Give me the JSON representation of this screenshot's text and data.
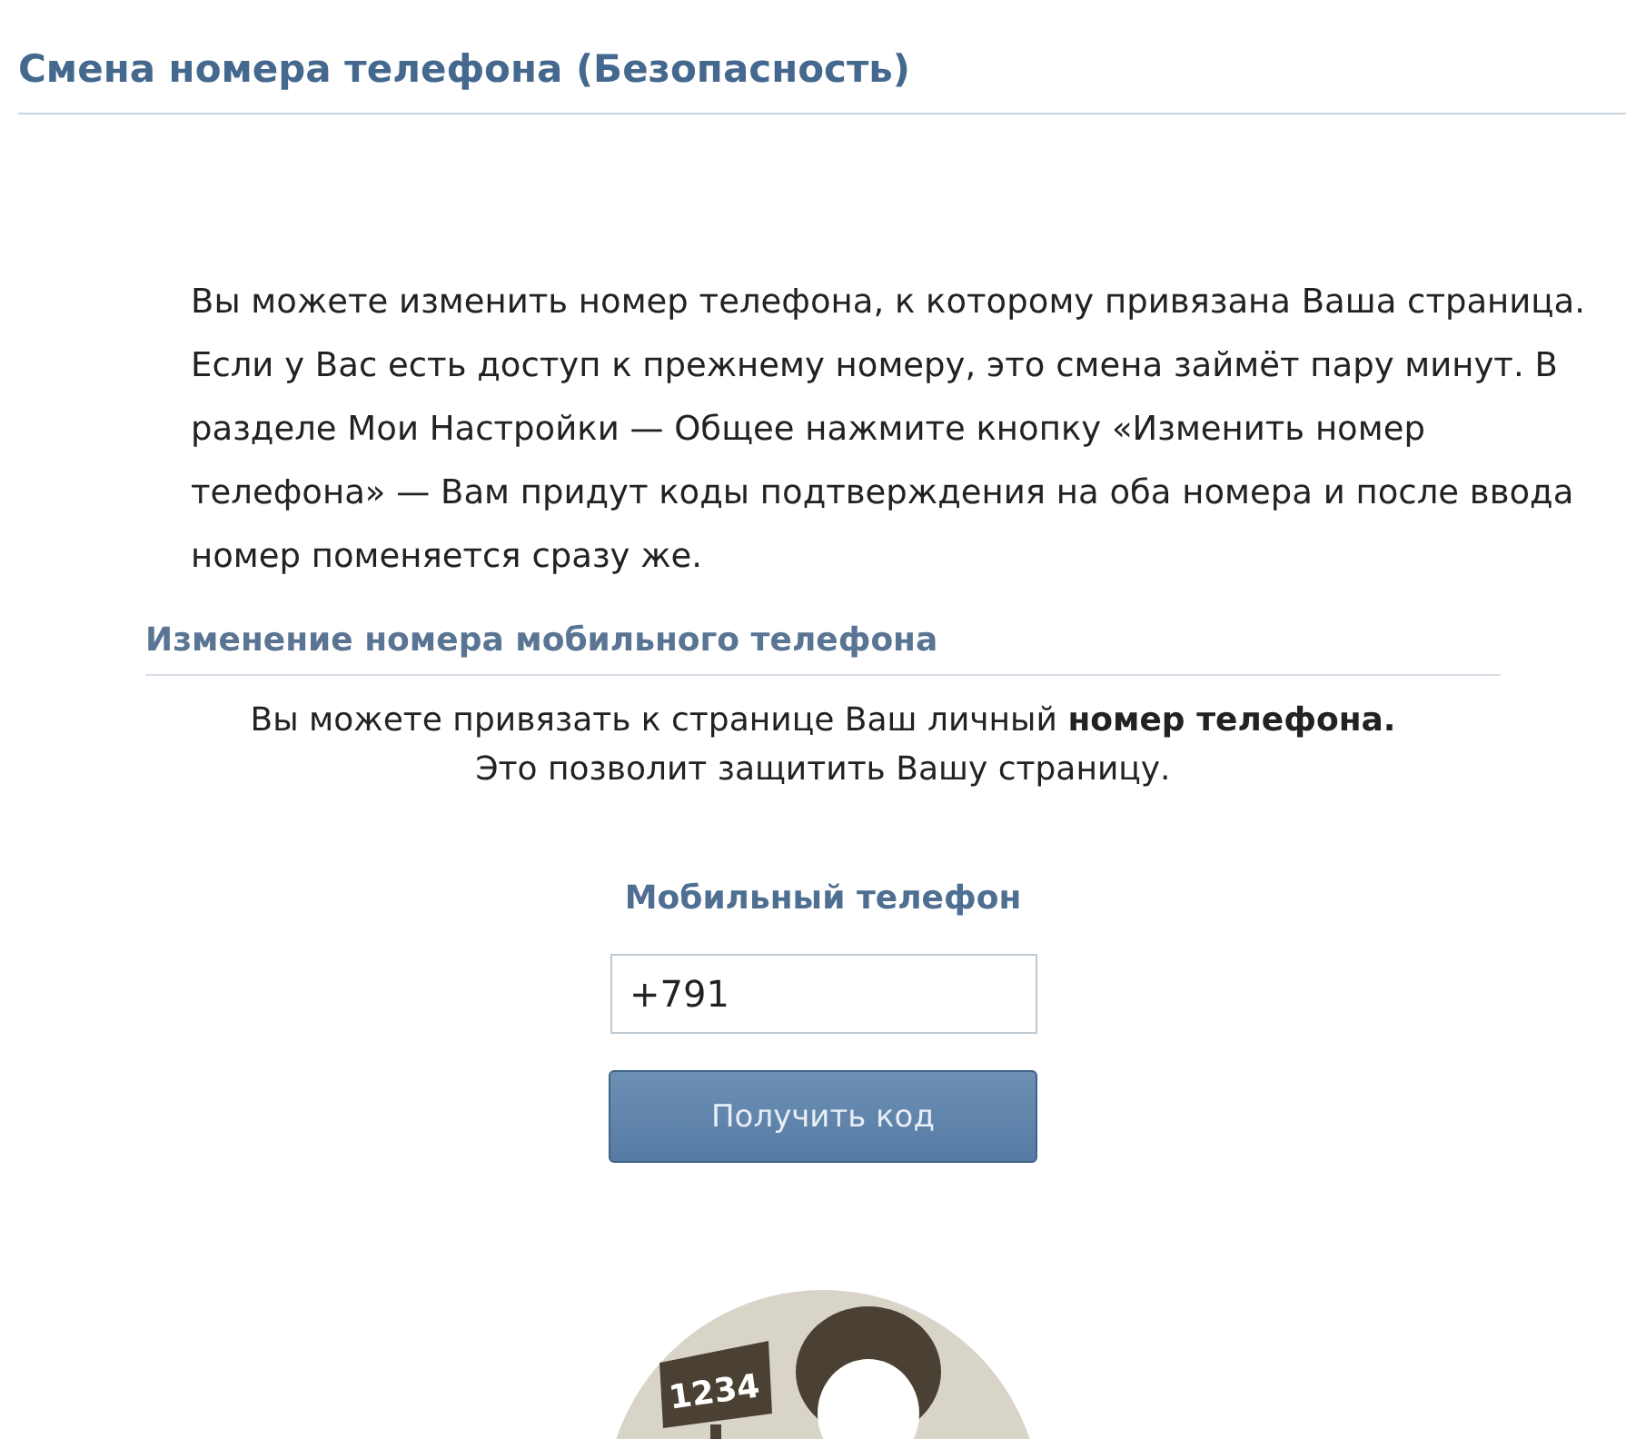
{
  "page_title": "Смена номера телефона (Безопасность)",
  "intro": "Вы можете изменить номер телефона, к которому привязана Ваша страница. Если у Вас есть доступ к прежнему номеру, это смена займёт пару минут. В разделе Мои Настройки — Общее нажмите кнопку «Изменить номер телефона» — Вам придут коды подтверждения на оба номера и после ввода номер поменяется сразу же.",
  "panel": {
    "title": "Изменение номера мобильного телефона",
    "lines": [
      "Вы можете привязать к странице Ваш личный **номер телефона.**",
      "Это позволит защитить Вашу страницу."
    ],
    "field_label": "Мобильный телефон",
    "phone_value": "+791",
    "button": "Получить код",
    "illustration": {
      "sign_text": "1234"
    }
  }
}
